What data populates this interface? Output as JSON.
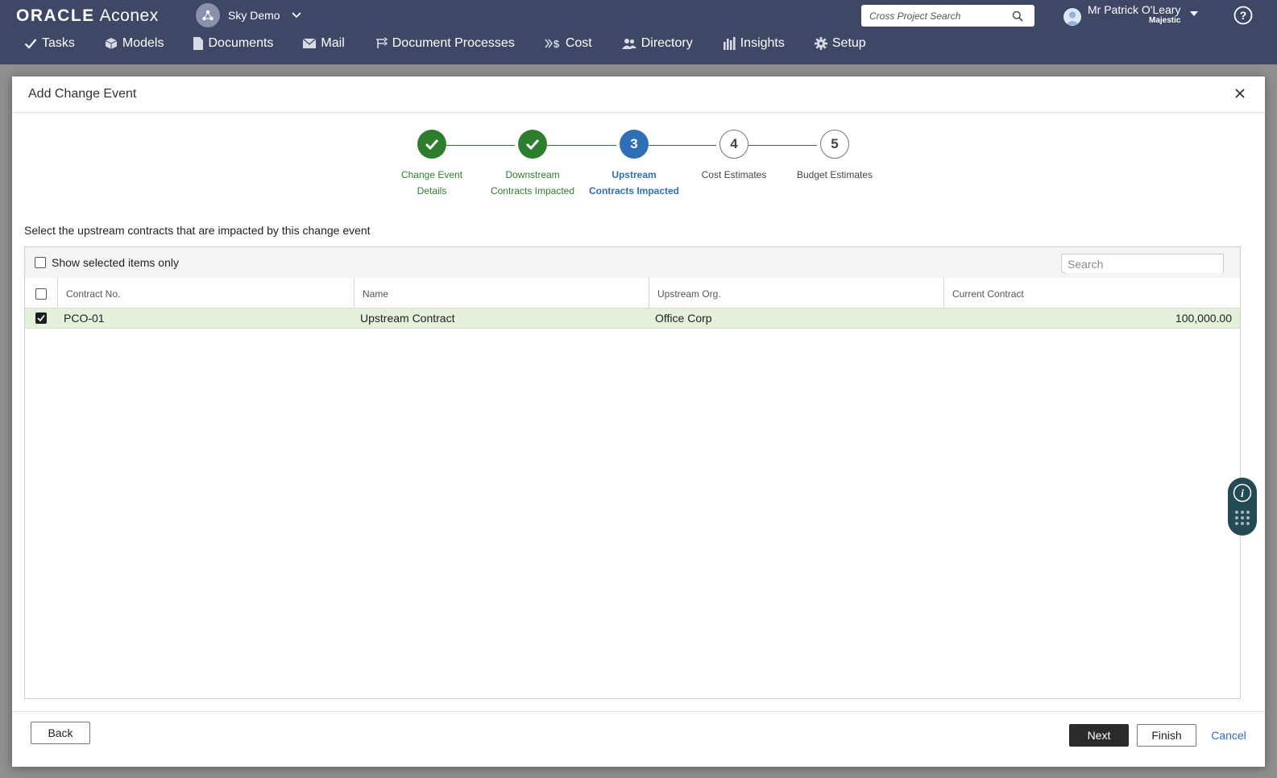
{
  "topbar": {
    "brand_oracle": "ORACLE",
    "brand_aconex": "Aconex",
    "project_name": "Sky Demo",
    "cross_search_placeholder": "Cross Project Search",
    "user_name": "Mr Patrick O'Leary",
    "user_org": "Majestic"
  },
  "nav": {
    "items": [
      {
        "label": "Tasks",
        "icon": "check-icon"
      },
      {
        "label": "Models",
        "icon": "cube-icon"
      },
      {
        "label": "Documents",
        "icon": "document-icon"
      },
      {
        "label": "Mail",
        "icon": "envelope-icon"
      },
      {
        "label": "Document Processes",
        "icon": "workflow-icon"
      },
      {
        "label": "Cost",
        "icon": "cost-icon"
      },
      {
        "label": "Directory",
        "icon": "people-icon"
      },
      {
        "label": "Insights",
        "icon": "bar-chart-icon"
      },
      {
        "label": "Setup",
        "icon": "gear-icon"
      }
    ]
  },
  "modal": {
    "title": "Add Change Event",
    "steps": [
      {
        "number": "1",
        "label_line1": "Change Event",
        "label_line2": "Details",
        "state": "done"
      },
      {
        "number": "2",
        "label_line1": "Downstream",
        "label_line2": "Contracts Impacted",
        "state": "done"
      },
      {
        "number": "3",
        "label_line1": "Upstream",
        "label_line2": "Contracts Impacted",
        "state": "active"
      },
      {
        "number": "4",
        "label_line1": "Cost Estimates",
        "label_line2": "",
        "state": "todo"
      },
      {
        "number": "5",
        "label_line1": "Budget Estimates",
        "label_line2": "",
        "state": "todo"
      }
    ],
    "instruction": "Select the upstream contracts that are impacted by this change event",
    "show_selected_label": "Show selected items only",
    "search_placeholder": "Search",
    "columns": [
      "Contract No.",
      "Name",
      "Upstream Org.",
      "Current Contract"
    ],
    "rows": [
      {
        "contract_no": "PCO-01",
        "name": "Upstream Contract",
        "org": "Office Corp",
        "current_contract": "100,000.00",
        "selected": true
      }
    ],
    "buttons": {
      "back": "Back",
      "next": "Next",
      "finish": "Finish",
      "cancel": "Cancel"
    }
  },
  "colors": {
    "topbar": "#3f4766",
    "step_done": "#2d7d2f",
    "step_active": "#2f6fb6",
    "selected_row": "#e3f0dc",
    "primary_button": "#2b2b2b"
  }
}
